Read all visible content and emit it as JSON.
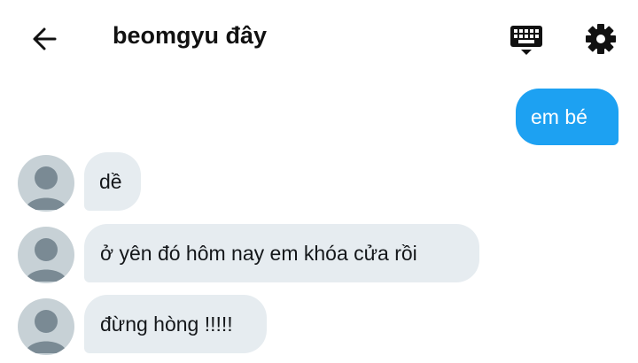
{
  "header": {
    "title": "beomgyu đây",
    "back_icon": "arrow-left-icon",
    "keyboard_icon": "keyboard-icon",
    "settings_icon": "gear-icon"
  },
  "messages": [
    {
      "direction": "sent",
      "text": "em bé"
    },
    {
      "direction": "received",
      "text": "dề"
    },
    {
      "direction": "received",
      "text": "ở yên đó hôm nay em khóa cửa rồi"
    },
    {
      "direction": "received",
      "text": "đừng hòng !!!!!"
    }
  ],
  "colors": {
    "sent_bubble": "#1da1f2",
    "received_bubble": "#e6ecf0",
    "avatar_bg": "#c7d1d6",
    "avatar_fg": "#7a8a94"
  }
}
